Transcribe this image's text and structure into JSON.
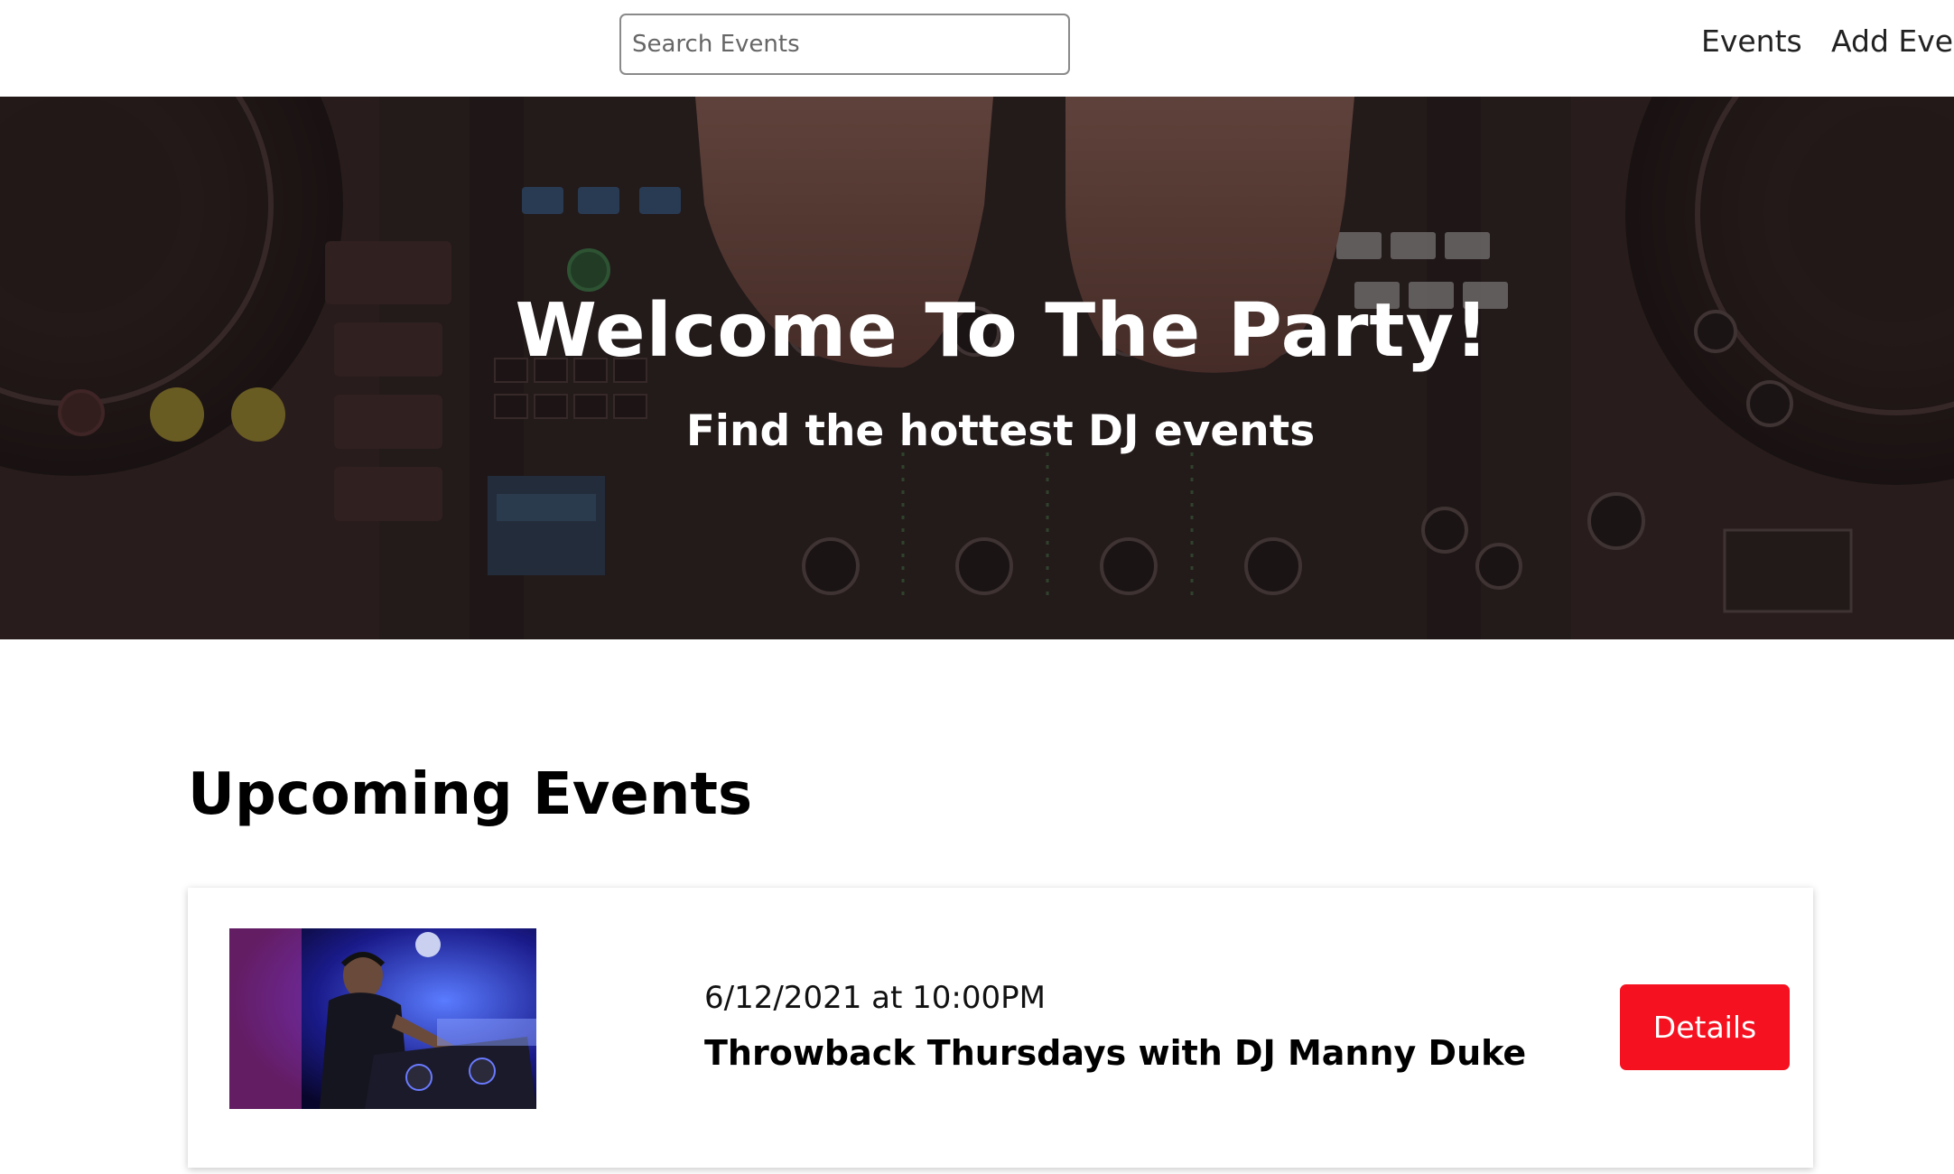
{
  "header": {
    "search": {
      "placeholder": "Search Events",
      "value": ""
    },
    "nav": {
      "events_label": "Events",
      "add_event_label": "Add Event"
    }
  },
  "hero": {
    "title": "Welcome To The Party!",
    "subtitle": "Find the hottest DJ events"
  },
  "events_section": {
    "title": "Upcoming Events",
    "events": [
      {
        "date": "6/12/2021 at 10:00PM",
        "name": "Throwback Thursdays with DJ Manny Duke",
        "details_label": "Details"
      }
    ]
  },
  "colors": {
    "accent": "#f5111f",
    "hero_overlay": "#1c1414"
  }
}
